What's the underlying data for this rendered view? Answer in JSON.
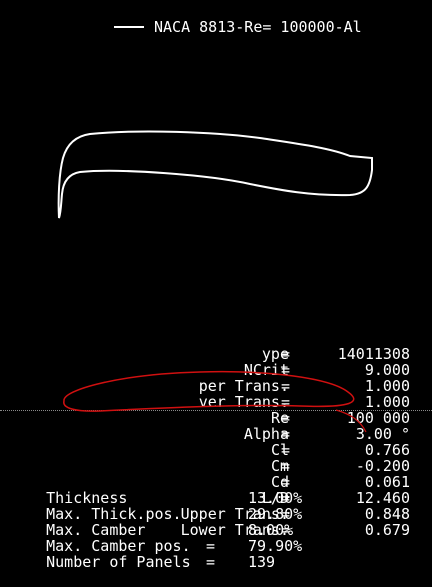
{
  "plot": {
    "legend_label": "NACA 8813-Re=  100000-Al"
  },
  "params": [
    {
      "label": "ype",
      "value": "14011308"
    },
    {
      "label": "NCrit",
      "value": "9.000"
    },
    {
      "label": "per Trans.",
      "value": "1.000"
    },
    {
      "label": "ver Trans.",
      "value": "1.000"
    },
    {
      "label": "Re",
      "value": "100 000"
    },
    {
      "label": "Alpha",
      "value": "3.00 °"
    },
    {
      "label": "Cl",
      "value": "0.766"
    },
    {
      "label": "Cm",
      "value": "-0.200"
    },
    {
      "label": "Cd",
      "value": "0.061"
    },
    {
      "label": "L/D",
      "value": "12.460"
    },
    {
      "label": "Upper Trans.",
      "value": "0.848"
    },
    {
      "label": "Lower Trans.",
      "value": "0.679"
    }
  ],
  "geometry": [
    {
      "label": "Thickness",
      "value": "13.00%"
    },
    {
      "label": "Max. Thick.pos.",
      "value": "29.80%"
    },
    {
      "label": "Max. Camber",
      "value": "8.00%"
    },
    {
      "label": "Max. Camber pos.",
      "value": "79.90%"
    },
    {
      "label": "Number of Panels",
      "value": "139"
    }
  ],
  "colors": {
    "background": "#000000",
    "text": "#ffffff",
    "annotation": "#d01010"
  }
}
